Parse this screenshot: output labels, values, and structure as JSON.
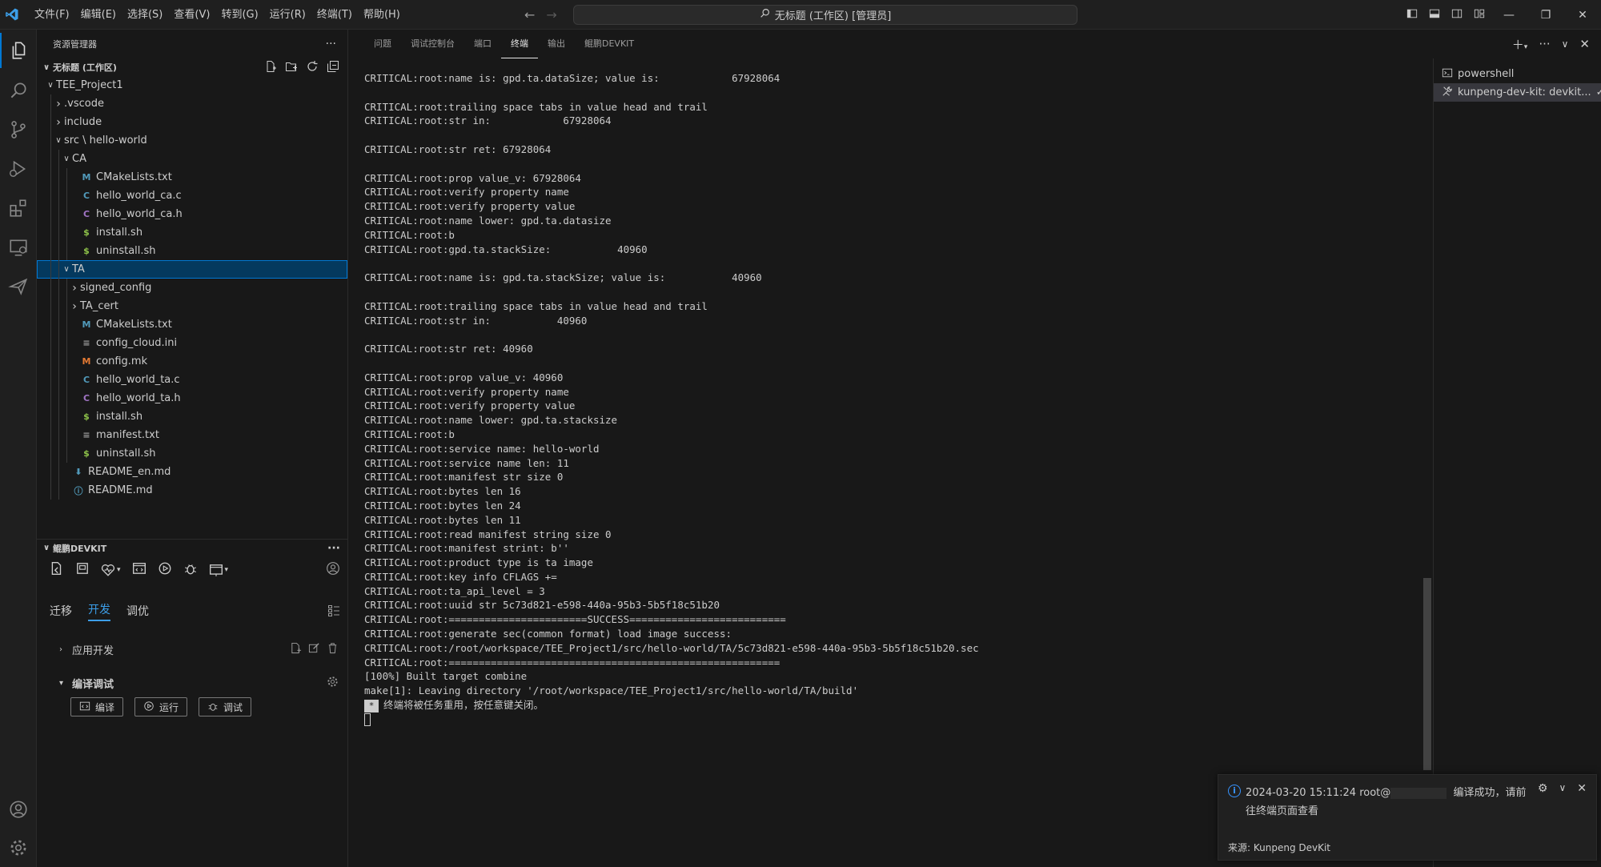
{
  "titlebar": {
    "menu": [
      "文件(F)",
      "编辑(E)",
      "选择(S)",
      "查看(V)",
      "转到(G)",
      "运行(R)",
      "终端(T)",
      "帮助(H)"
    ],
    "command_center": "无标题 (工作区) [管理员]"
  },
  "explorer": {
    "header": "资源管理器",
    "workspace_title": "无标题 (工作区)",
    "tree": [
      {
        "label": "TEE_Project1",
        "depth": 0,
        "twist": "v",
        "icon": "",
        "icon_color": ""
      },
      {
        "label": ".vscode",
        "depth": 1,
        "twist": ">",
        "icon": "",
        "icon_color": ""
      },
      {
        "label": "include",
        "depth": 1,
        "twist": ">",
        "icon": "",
        "icon_color": ""
      },
      {
        "label": "src \\ hello-world",
        "depth": 1,
        "twist": "v",
        "icon": "",
        "icon_color": ""
      },
      {
        "label": "CA",
        "depth": 2,
        "twist": "v",
        "icon": "",
        "icon_color": ""
      },
      {
        "label": "CMakeLists.txt",
        "depth": 3,
        "twist": "",
        "icon": "M",
        "icon_color": "#519aba"
      },
      {
        "label": "hello_world_ca.c",
        "depth": 3,
        "twist": "",
        "icon": "C",
        "icon_color": "#519aba"
      },
      {
        "label": "hello_world_ca.h",
        "depth": 3,
        "twist": "",
        "icon": "C",
        "icon_color": "#a074c4"
      },
      {
        "label": "install.sh",
        "depth": 3,
        "twist": "",
        "icon": "$",
        "icon_color": "#8dc149"
      },
      {
        "label": "uninstall.sh",
        "depth": 3,
        "twist": "",
        "icon": "$",
        "icon_color": "#8dc149"
      },
      {
        "label": "TA",
        "depth": 2,
        "twist": "v",
        "icon": "",
        "icon_color": "",
        "selected": true
      },
      {
        "label": "signed_config",
        "depth": 3,
        "twist": ">",
        "icon": "",
        "icon_color": ""
      },
      {
        "label": "TA_cert",
        "depth": 3,
        "twist": ">",
        "icon": "",
        "icon_color": ""
      },
      {
        "label": "CMakeLists.txt",
        "depth": 3,
        "twist": "",
        "icon": "M",
        "icon_color": "#519aba"
      },
      {
        "label": "config_cloud.ini",
        "depth": 3,
        "twist": "",
        "icon": "≡",
        "icon_color": "#9d9d9d"
      },
      {
        "label": "config.mk",
        "depth": 3,
        "twist": "",
        "icon": "M",
        "icon_color": "#e37933"
      },
      {
        "label": "hello_world_ta.c",
        "depth": 3,
        "twist": "",
        "icon": "C",
        "icon_color": "#519aba"
      },
      {
        "label": "hello_world_ta.h",
        "depth": 3,
        "twist": "",
        "icon": "C",
        "icon_color": "#a074c4"
      },
      {
        "label": "install.sh",
        "depth": 3,
        "twist": "",
        "icon": "$",
        "icon_color": "#8dc149"
      },
      {
        "label": "manifest.txt",
        "depth": 3,
        "twist": "",
        "icon": "≡",
        "icon_color": "#9d9d9d"
      },
      {
        "label": "uninstall.sh",
        "depth": 3,
        "twist": "",
        "icon": "$",
        "icon_color": "#8dc149"
      },
      {
        "label": "README_en.md",
        "depth": 2,
        "twist": "",
        "icon": "⬇",
        "icon_color": "#519aba"
      },
      {
        "label": "README.md",
        "depth": 2,
        "twist": "",
        "icon": "ⓘ",
        "icon_color": "#519aba"
      }
    ]
  },
  "devkit": {
    "title": "鲲鹏DEVKIT",
    "tabs": [
      "迁移",
      "开发",
      "调优"
    ],
    "active_tab": "开发",
    "sections": [
      {
        "label": "应用开发",
        "twist": ">"
      },
      {
        "label": "编译调试",
        "twist": "v"
      }
    ],
    "buttons": [
      "编译",
      "运行",
      "调试"
    ]
  },
  "panel": {
    "tabs": [
      "问题",
      "调试控制台",
      "端口",
      "终端",
      "输出",
      "鲲鹏DEVKIT"
    ],
    "active_tab": "终端",
    "terminals": [
      "powershell",
      "kunpeng-dev-kit: devkit..."
    ]
  },
  "terminal": {
    "lines": [
      "CRITICAL:root:name is: gpd.ta.dataSize; value is:            67928064",
      "",
      "CRITICAL:root:trailing space tabs in value head and trail",
      "CRITICAL:root:str in:            67928064",
      "",
      "CRITICAL:root:str ret: 67928064",
      "",
      "CRITICAL:root:prop value_v: 67928064",
      "CRITICAL:root:verify property name",
      "CRITICAL:root:verify property value",
      "CRITICAL:root:name lower: gpd.ta.datasize",
      "CRITICAL:root:b",
      "CRITICAL:root:gpd.ta.stackSize:           40960",
      "",
      "CRITICAL:root:name is: gpd.ta.stackSize; value is:           40960",
      "",
      "CRITICAL:root:trailing space tabs in value head and trail",
      "CRITICAL:root:str in:           40960",
      "",
      "CRITICAL:root:str ret: 40960",
      "",
      "CRITICAL:root:prop value_v: 40960",
      "CRITICAL:root:verify property name",
      "CRITICAL:root:verify property value",
      "CRITICAL:root:name lower: gpd.ta.stacksize",
      "CRITICAL:root:b",
      "CRITICAL:root:service name: hello-world",
      "CRITICAL:root:service name len: 11",
      "CRITICAL:root:manifest str size 0",
      "CRITICAL:root:bytes len 16",
      "CRITICAL:root:bytes len 24",
      "CRITICAL:root:bytes len 11",
      "CRITICAL:root:read manifest string size 0",
      "CRITICAL:root:manifest strint: b''",
      "CRITICAL:root:product type is ta image",
      "CRITICAL:root:key info CFLAGS +=",
      "CRITICAL:root:ta_api_level = 3",
      "CRITICAL:root:uuid str 5c73d821-e598-440a-95b3-5b5f18c51b20",
      "CRITICAL:root:=======================SUCCESS==========================",
      "CRITICAL:root:generate sec(common format) load image success:",
      "CRITICAL:root:/root/workspace/TEE_Project1/src/hello-world/TA/5c73d821-e598-440a-95b3-5b5f18c51b20.sec",
      "CRITICAL:root:=======================================================",
      "[100%] Built target combine",
      "make[1]: Leaving directory '/root/workspace/TEE_Project1/src/hello-world/TA/build'"
    ],
    "final_message": "终端将被任务重用，按任意键关闭。",
    "final_marker": "*"
  },
  "notification": {
    "text_before": "2024-03-20 15:11:24 root@",
    "text_after": "编译成功，请前",
    "text_line2": "往终端页面查看",
    "source": "来源: Kunpeng DevKit"
  },
  "colors": {
    "accent": "#0078d4",
    "link": "#3c9ee8"
  }
}
